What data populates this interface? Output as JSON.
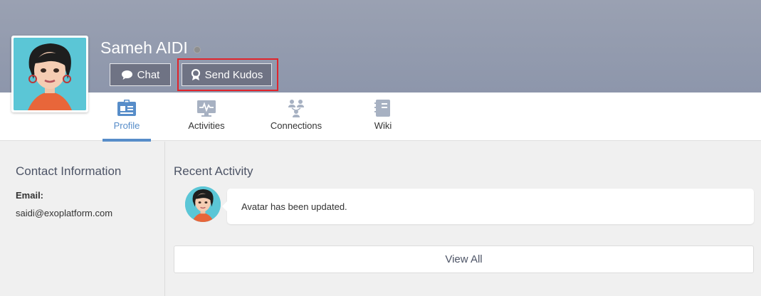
{
  "profile": {
    "name": "Sameh AIDI",
    "chat_label": "Chat",
    "kudos_label": "Send Kudos"
  },
  "tabs": [
    {
      "label": "Profile",
      "icon": "profile-card-icon",
      "active": true
    },
    {
      "label": "Activities",
      "icon": "activities-monitor-icon"
    },
    {
      "label": "Connections",
      "icon": "connections-icon"
    },
    {
      "label": "Wiki",
      "icon": "wiki-notebook-icon"
    }
  ],
  "contact": {
    "title": "Contact Information",
    "email_label": "Email:",
    "email_value": "saidi@exoplatform.com"
  },
  "recent": {
    "title": "Recent Activity",
    "activity_text": "Avatar has been updated.",
    "view_all_label": "View All"
  },
  "colors": {
    "banner": "#8d96ab",
    "accent": "#578dc9",
    "highlight": "#e0242b",
    "button_bg": "#6f7384"
  }
}
